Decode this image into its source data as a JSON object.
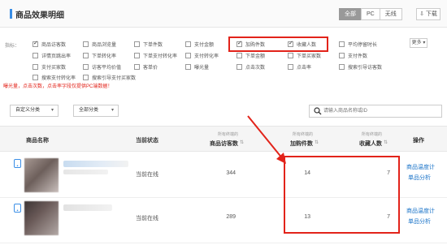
{
  "header": {
    "title": "商品效果明细",
    "device_tabs": [
      "全部",
      "PC",
      "无线"
    ],
    "active_tab_index": 0,
    "download_label": "下载"
  },
  "metrics": {
    "label": "指标：",
    "items": [
      {
        "label": "商品访客数",
        "checked": true
      },
      {
        "label": "商品浏览量",
        "checked": false
      },
      {
        "label": "下单件数",
        "checked": false
      },
      {
        "label": "支付金额",
        "checked": false
      },
      {
        "label": "加购件数",
        "checked": true
      },
      {
        "label": "收藏人数",
        "checked": true
      },
      {
        "label": "平均停留时长",
        "checked": false
      },
      {
        "label": "详情页跳出率",
        "checked": false
      },
      {
        "label": "下单转化率",
        "checked": false
      },
      {
        "label": "下单支付转化率",
        "checked": false
      },
      {
        "label": "支付转化率",
        "checked": false
      },
      {
        "label": "下单金额",
        "checked": false
      },
      {
        "label": "下单买家数",
        "checked": false
      },
      {
        "label": "支付件数",
        "checked": false
      },
      {
        "label": "支付买家数",
        "checked": false
      },
      {
        "label": "访客平均价值",
        "checked": false
      },
      {
        "label": "客单价",
        "checked": false
      },
      {
        "label": "曝光量",
        "checked": false
      },
      {
        "label": "点击次数",
        "checked": false
      },
      {
        "label": "点击率",
        "checked": false
      },
      {
        "label": "搜索引导访客数",
        "checked": false
      },
      {
        "label": "搜索支付转化率",
        "checked": false
      },
      {
        "label": "搜索引导支付买家数",
        "checked": false
      }
    ],
    "more_label": "更多",
    "warning": "曝光量，点击次数，点击率字段仅提供PC端数据！"
  },
  "filters": {
    "custom_category": "自定义分类",
    "all_category": "全部分类",
    "search_placeholder": "请输入商品名称或ID"
  },
  "table": {
    "columns": {
      "name": "商品名称",
      "status": "当前状态",
      "visitors_sub": "所有终端的",
      "visitors": "商品访客数",
      "cart_sub": "所有终端的",
      "cart": "加购件数",
      "fav_sub": "所有终端的",
      "fav": "收藏人数",
      "ops": "操作"
    },
    "rows": [
      {
        "status": "当前在线",
        "visitors": "344",
        "cart": "14",
        "fav": "7",
        "op1": "商品温度计",
        "op2": "单品分析"
      },
      {
        "status": "当前在线",
        "visitors": "289",
        "cart": "13",
        "fav": "7",
        "op1": "商品温度计",
        "op2": "单品分析"
      }
    ]
  },
  "colors": {
    "accent": "#3a8ee6",
    "highlight_red": "#e2231a",
    "link_blue": "#1a73c8"
  }
}
